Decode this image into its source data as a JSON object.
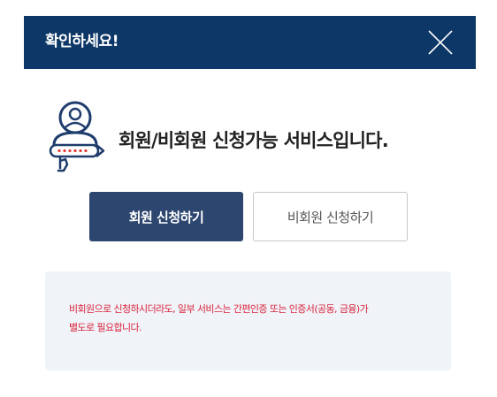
{
  "header": {
    "title": "확인하세요!",
    "background": "#0c3766"
  },
  "intro": {
    "message": "회원/비회원 신청가능 서비스입니다."
  },
  "buttons": {
    "member": "회원 신청하기",
    "nonmember": "비회원 신청하기"
  },
  "notice": {
    "lines": [
      "비회원으로 신청하시더라도, 일부 서비스는 간편인증 또는 인증서(공동, 금융)가",
      "별도로 필요합니다."
    ],
    "color": "#d9223c"
  },
  "icons": {
    "close": "close-icon",
    "person": "user-login-icon"
  }
}
